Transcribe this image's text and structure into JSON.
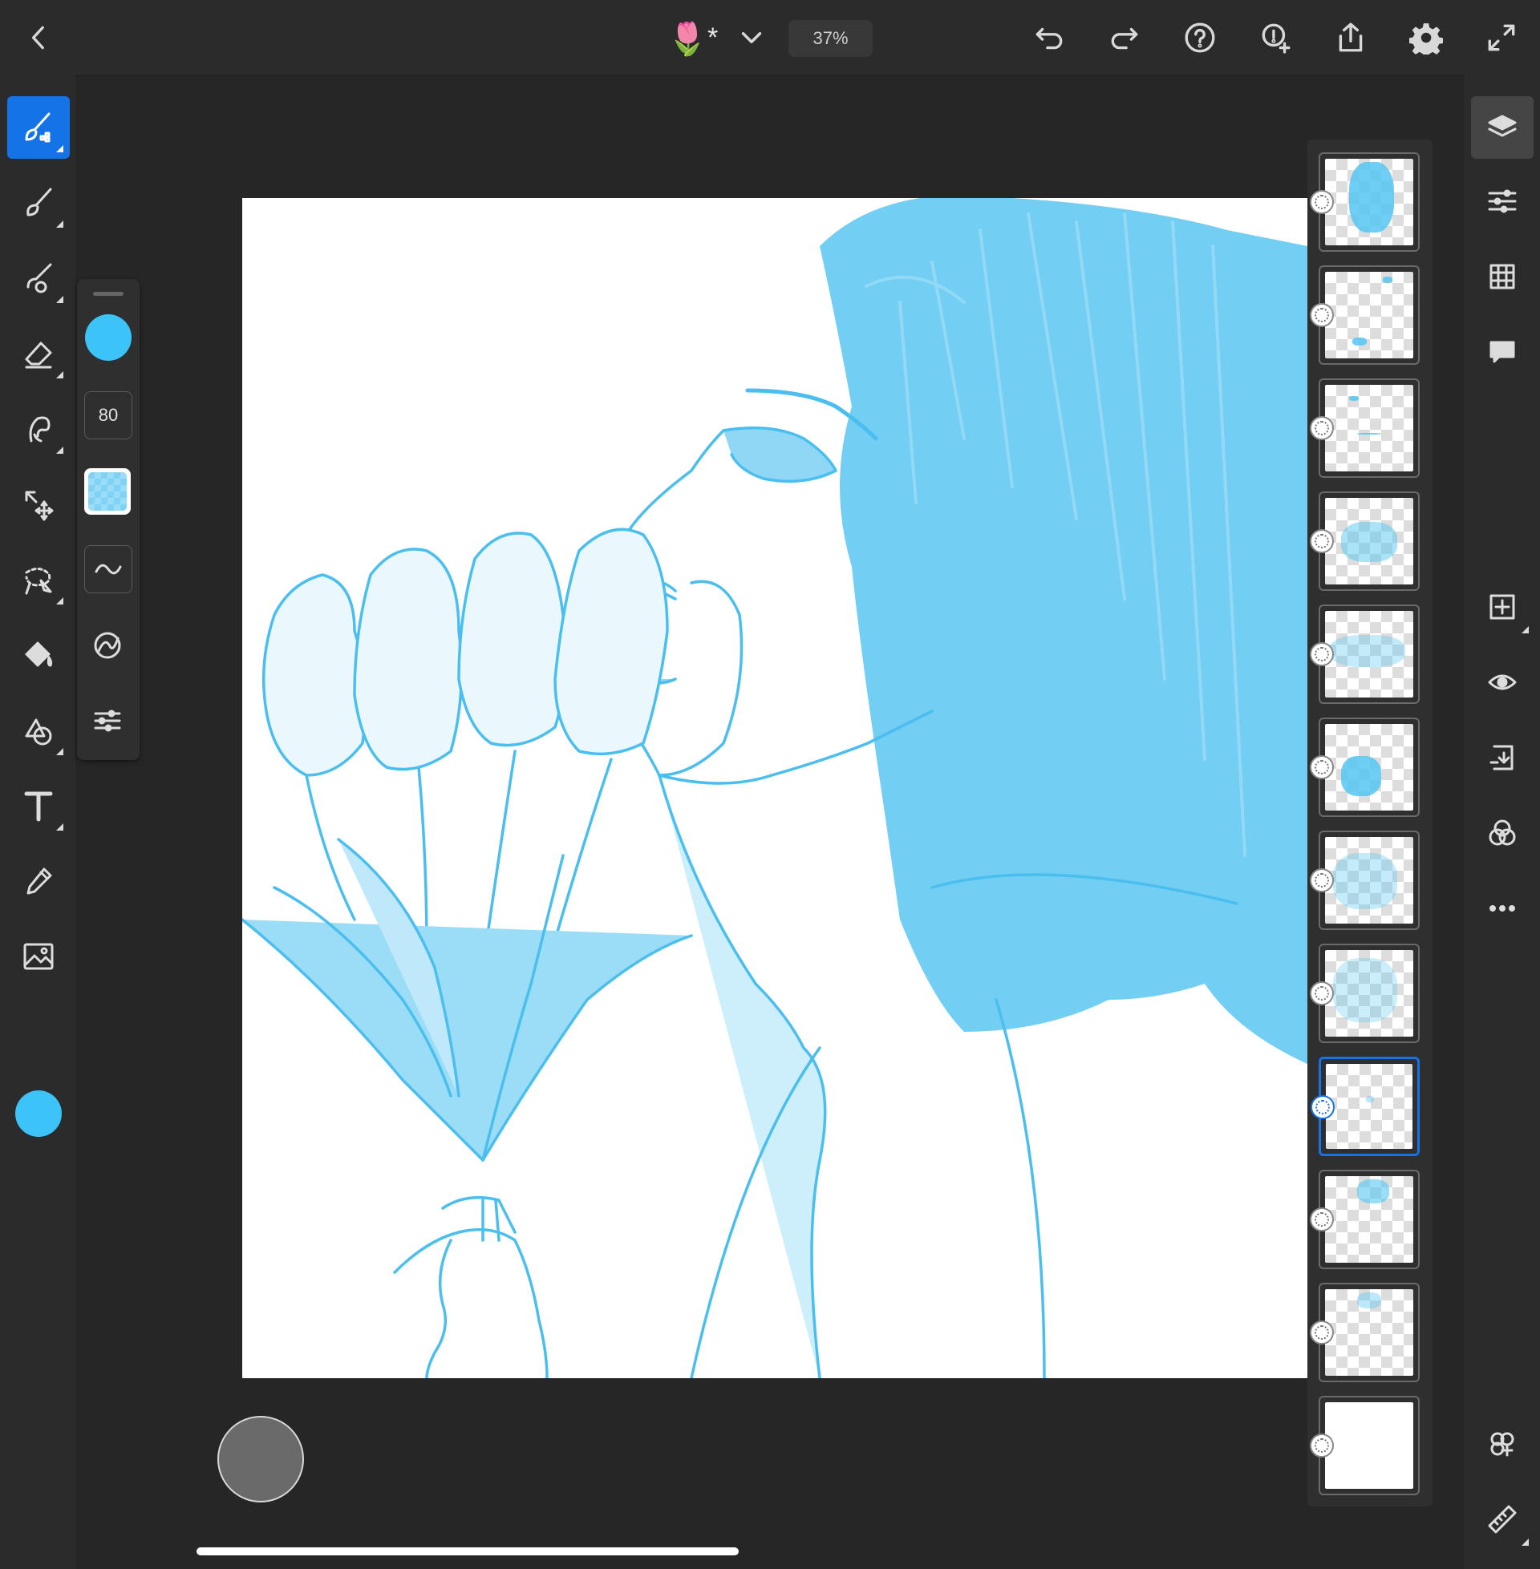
{
  "app": {
    "doc_emoji": "🌷",
    "modified_marker": "*",
    "zoom": "37%"
  },
  "colors": {
    "accent": "#1473e6",
    "brush_color": "#3cc3f7",
    "ink": "#4bbef0"
  },
  "topbar": {
    "icons": [
      "back-chevron-icon",
      "dropdown-chevron-icon",
      "undo-icon",
      "redo-icon",
      "help-icon",
      "invite-icon",
      "share-icon",
      "settings-icon",
      "fullscreen-icon"
    ]
  },
  "left_toolbar": {
    "tools": [
      "paint-brush-icon",
      "brush-icon",
      "smudge-brush-icon",
      "eraser-icon",
      "liquify-icon",
      "move-icon",
      "lasso-icon",
      "fill-icon",
      "shape-icon",
      "text-icon",
      "eyedropper-icon",
      "image-icon"
    ]
  },
  "brush_panel": {
    "size": "80"
  },
  "layers": {
    "count": 12,
    "selected_index": 8
  },
  "right_toolbar": {
    "icons": [
      "layers-icon",
      "adjustments-icon",
      "grid-icon",
      "comments-icon",
      "add-layer-icon",
      "visibility-icon",
      "merge-down-icon",
      "blend-icon",
      "more-icon",
      "layer-properties-icon",
      "ruler-icon"
    ]
  }
}
